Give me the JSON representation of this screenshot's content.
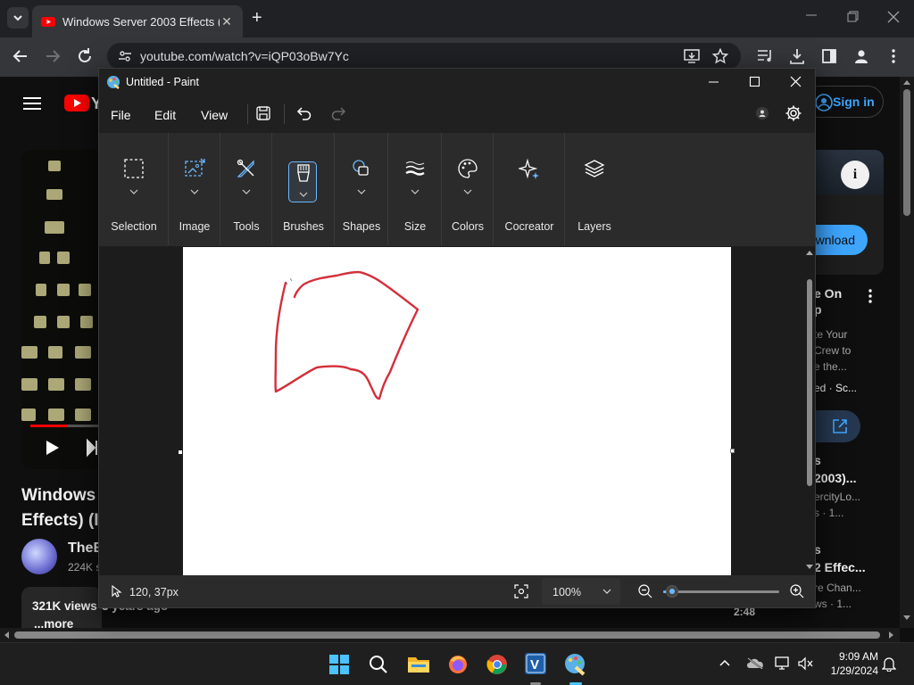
{
  "browser": {
    "tab_title": "Windows Server 2003 Effects (S",
    "url": "youtube.com/watch?v=iQP03oBw7Yc"
  },
  "youtube": {
    "sign_in": "Sign in",
    "download": "wnload",
    "video_title_line1": "Windows",
    "video_title_line2": "Effects) (I",
    "channel_name": "TheE",
    "channel_subs": "224K s",
    "views": "321K views",
    "views_suffix": "3 years ago",
    "more": "...more",
    "side1_title": "e On",
    "side1_title2": "p",
    "side1_line1": "te Your",
    "side1_line2": "Crew to",
    "side1_line3": "e the...",
    "side1_meta": "ed · Sc...",
    "side2_title": "s",
    "side2_title2": "2003)...",
    "side2_channel": "ercityLo...",
    "side2_meta": "s · 1...",
    "side3_title": "s",
    "side3_title2": "2 Effec...",
    "side3_channel": "re Chan...",
    "side3_meta": "ws · 1...",
    "duration": "2:48"
  },
  "paint": {
    "title": "Untitled - Paint",
    "menu": {
      "file": "File",
      "edit": "Edit",
      "view": "View"
    },
    "groups": {
      "selection": "Selection",
      "image": "Image",
      "tools": "Tools",
      "brushes": "Brushes",
      "shapes": "Shapes",
      "size": "Size",
      "colors": "Colors",
      "cocreator": "Cocreator",
      "layers": "Layers"
    },
    "status": {
      "cursor_pos": "120, 37px",
      "zoom": "100%"
    },
    "zoom_level": 0.08,
    "brush_color": "#d32f3a"
  },
  "taskbar": {
    "time": "9:09 AM",
    "date": "1/29/2024"
  }
}
